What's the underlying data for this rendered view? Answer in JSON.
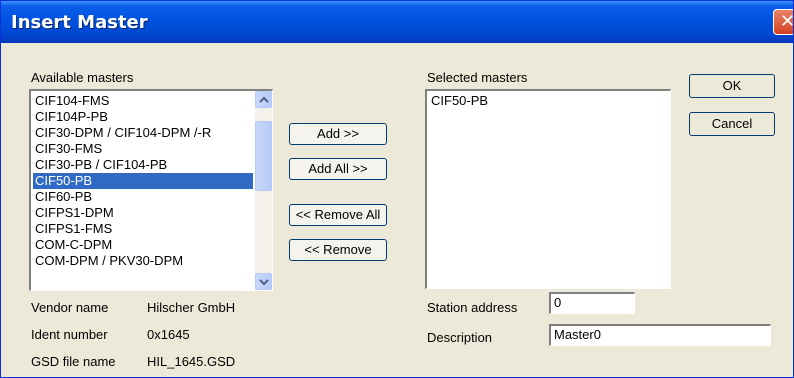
{
  "window": {
    "title": "Insert Master",
    "close_label": "✕"
  },
  "available": {
    "label": "Available masters",
    "items": [
      "CIF104-FMS",
      "CIF104P-PB",
      "CIF30-DPM / CIF104-DPM /-R",
      "CIF30-FMS",
      "CIF30-PB / CIF104-PB",
      "CIF50-PB",
      "CIF60-PB",
      "CIFPS1-DPM",
      "CIFPS1-FMS",
      "COM-C-DPM",
      "COM-DPM / PKV30-DPM"
    ],
    "selected_index": 5
  },
  "selected": {
    "label": "Selected masters",
    "items": [
      "CIF50-PB"
    ]
  },
  "buttons": {
    "add": "Add >>",
    "add_all": "Add All >>",
    "remove_all": "<< Remove All",
    "remove": "<< Remove",
    "ok": "OK",
    "cancel": "Cancel"
  },
  "info": {
    "vendor_label": "Vendor name",
    "vendor_value": "Hilscher GmbH",
    "ident_label": "Ident number",
    "ident_value": "0x1645",
    "gsd_label": "GSD file name",
    "gsd_value": "HIL_1645.GSD"
  },
  "station": {
    "label": "Station address",
    "value": "0"
  },
  "description": {
    "label": "Description",
    "value": "Master0"
  }
}
